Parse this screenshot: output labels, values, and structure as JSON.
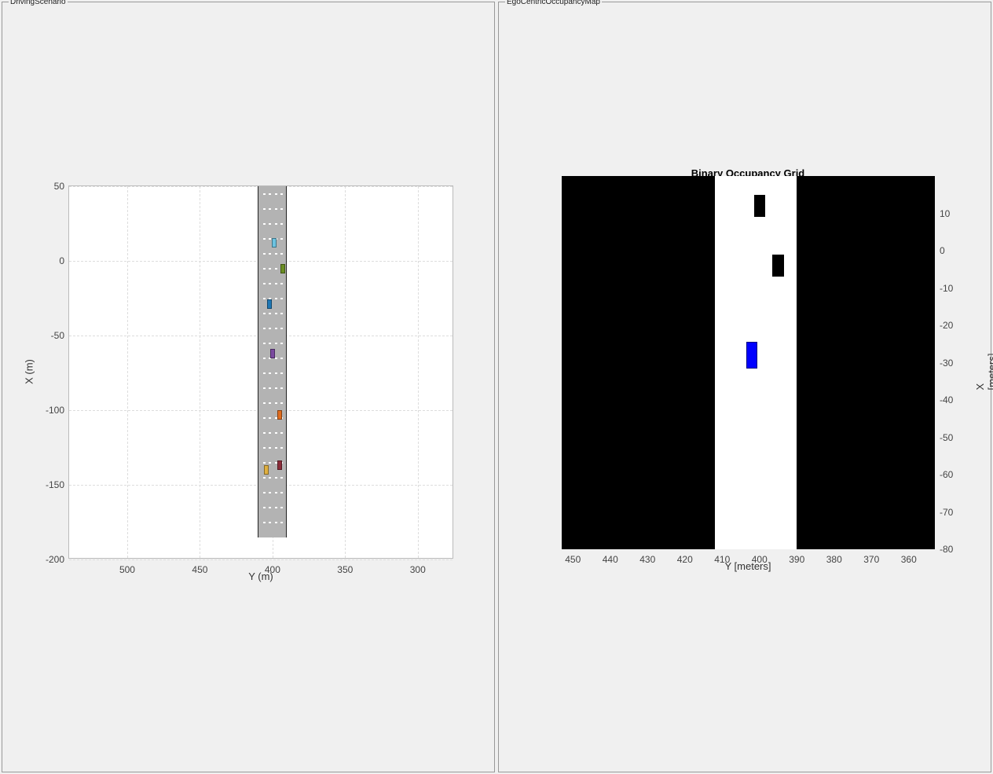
{
  "panels": {
    "left": {
      "title": "DrivingScenario"
    },
    "right": {
      "title": "EgoCentricOccupancyMap"
    }
  },
  "chart_data": [
    {
      "id": "scenario",
      "type": "scatter",
      "title": "",
      "xlabel": "Y (m)",
      "ylabel": "X (m)",
      "xlim": [
        275,
        540
      ],
      "ylim": [
        -200,
        50
      ],
      "xticks": [
        300,
        350,
        400,
        450,
        500
      ],
      "yticks": [
        -200,
        -150,
        -100,
        -50,
        0,
        50
      ],
      "road": {
        "y_center": 400,
        "width_m": 20,
        "x_top": 50,
        "x_bottom": -185
      },
      "lane_dash_cols": [
        394,
        398,
        402,
        406
      ],
      "lane_dash_rows": [
        45,
        35,
        25,
        15,
        5,
        -5,
        -15,
        -25,
        -35,
        -45,
        -55,
        -65,
        -75,
        -85,
        -95,
        -105,
        -115,
        -125,
        -135,
        -145,
        -155,
        -165,
        -175
      ],
      "vehicles": [
        {
          "name": "veh-skyblue",
          "y": 399,
          "x": 12,
          "color": "#6cc2e0"
        },
        {
          "name": "veh-green",
          "y": 393,
          "x": -5,
          "color": "#6b8e23"
        },
        {
          "name": "veh-blue",
          "y": 402,
          "x": -29,
          "color": "#1f77b4"
        },
        {
          "name": "veh-purple",
          "y": 400,
          "x": -62,
          "color": "#7b4aa0"
        },
        {
          "name": "veh-orange",
          "y": 395,
          "x": -103,
          "color": "#e06c1f"
        },
        {
          "name": "veh-maroon",
          "y": 395,
          "x": -137,
          "color": "#8b2d3a"
        },
        {
          "name": "veh-yellow",
          "y": 404,
          "x": -140,
          "color": "#e0b040"
        }
      ]
    },
    {
      "id": "occupancy",
      "type": "heatmap",
      "title": "Binary Occupancy Grid",
      "xlabel": "Y [meters]",
      "ylabel": "X [meters]",
      "xlim": [
        353,
        453
      ],
      "ylim": [
        -80,
        20
      ],
      "xticks": [
        360,
        370,
        380,
        390,
        400,
        410,
        420,
        430,
        440,
        450
      ],
      "yticks": [
        -80,
        -70,
        -60,
        -50,
        -40,
        -30,
        -20,
        -10,
        0,
        10
      ],
      "free_strip": {
        "y_min": 390,
        "y_max": 412
      },
      "obstacles": [
        {
          "y": 400,
          "x": 12,
          "w": 3,
          "h": 6
        },
        {
          "y": 395,
          "x": -4,
          "w": 3,
          "h": 6
        }
      ],
      "ego": {
        "y": 402,
        "x": -28,
        "w": 3,
        "h": 7
      }
    }
  ]
}
